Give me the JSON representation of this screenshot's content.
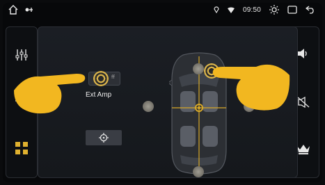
{
  "status": {
    "time": "09:50",
    "icons": [
      "home-icon",
      "usb-icon",
      "location-icon",
      "wifi-icon",
      "brightness-icon",
      "window-icon",
      "back-icon"
    ]
  },
  "left_nav": [
    {
      "icon": "equalizer-icon",
      "active": false
    },
    {
      "icon": "waveform-icon",
      "active": false
    },
    {
      "icon": "balance-fader-icon",
      "active": true
    }
  ],
  "right_nav": [
    {
      "icon": "volume-icon",
      "active": false
    },
    {
      "icon": "mute-speaker-icon",
      "active": false
    },
    {
      "icon": "crown-icon",
      "active": false
    }
  ],
  "main": {
    "ext_amp_label": "Ext Amp",
    "ext_amp_toggle_text": "ff",
    "center_button_icon": "target-icon"
  },
  "colors": {
    "accent": "#d8a928",
    "hand": "#f2b720",
    "panel": "#17191e"
  }
}
